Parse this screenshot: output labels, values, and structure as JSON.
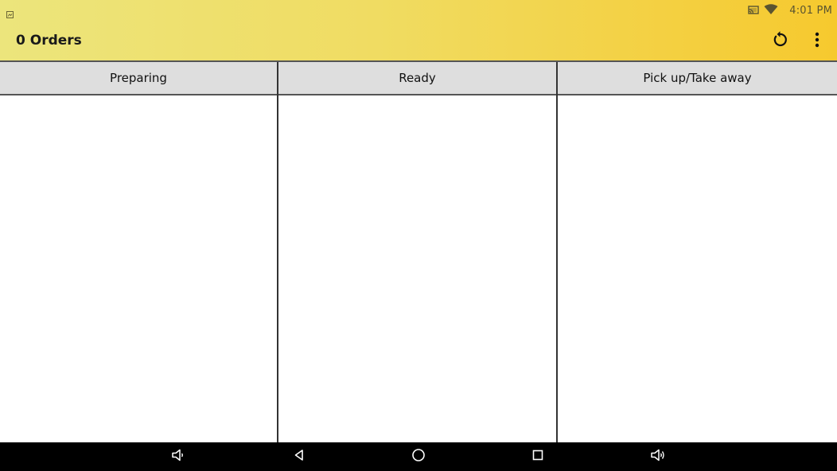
{
  "status_bar": {
    "time": "4:01 PM",
    "icons": [
      "notification-icon",
      "cast-icon",
      "wifi-icon"
    ]
  },
  "app_bar": {
    "title": "0 Orders",
    "actions": [
      "refresh-icon",
      "more-vert-icon"
    ]
  },
  "columns": [
    {
      "label": "Preparing"
    },
    {
      "label": "Ready"
    },
    {
      "label": "Pick up/Take away"
    }
  ],
  "nav_bar": {
    "buttons": [
      "volume-down-icon",
      "back-icon",
      "home-icon",
      "recents-icon",
      "volume-up-icon"
    ]
  },
  "colors": {
    "appbar_gradient_start": "#ece57c",
    "appbar_gradient_end": "#f6c92e",
    "column_header_bg": "#dedede",
    "navbar_bg": "#000000"
  }
}
